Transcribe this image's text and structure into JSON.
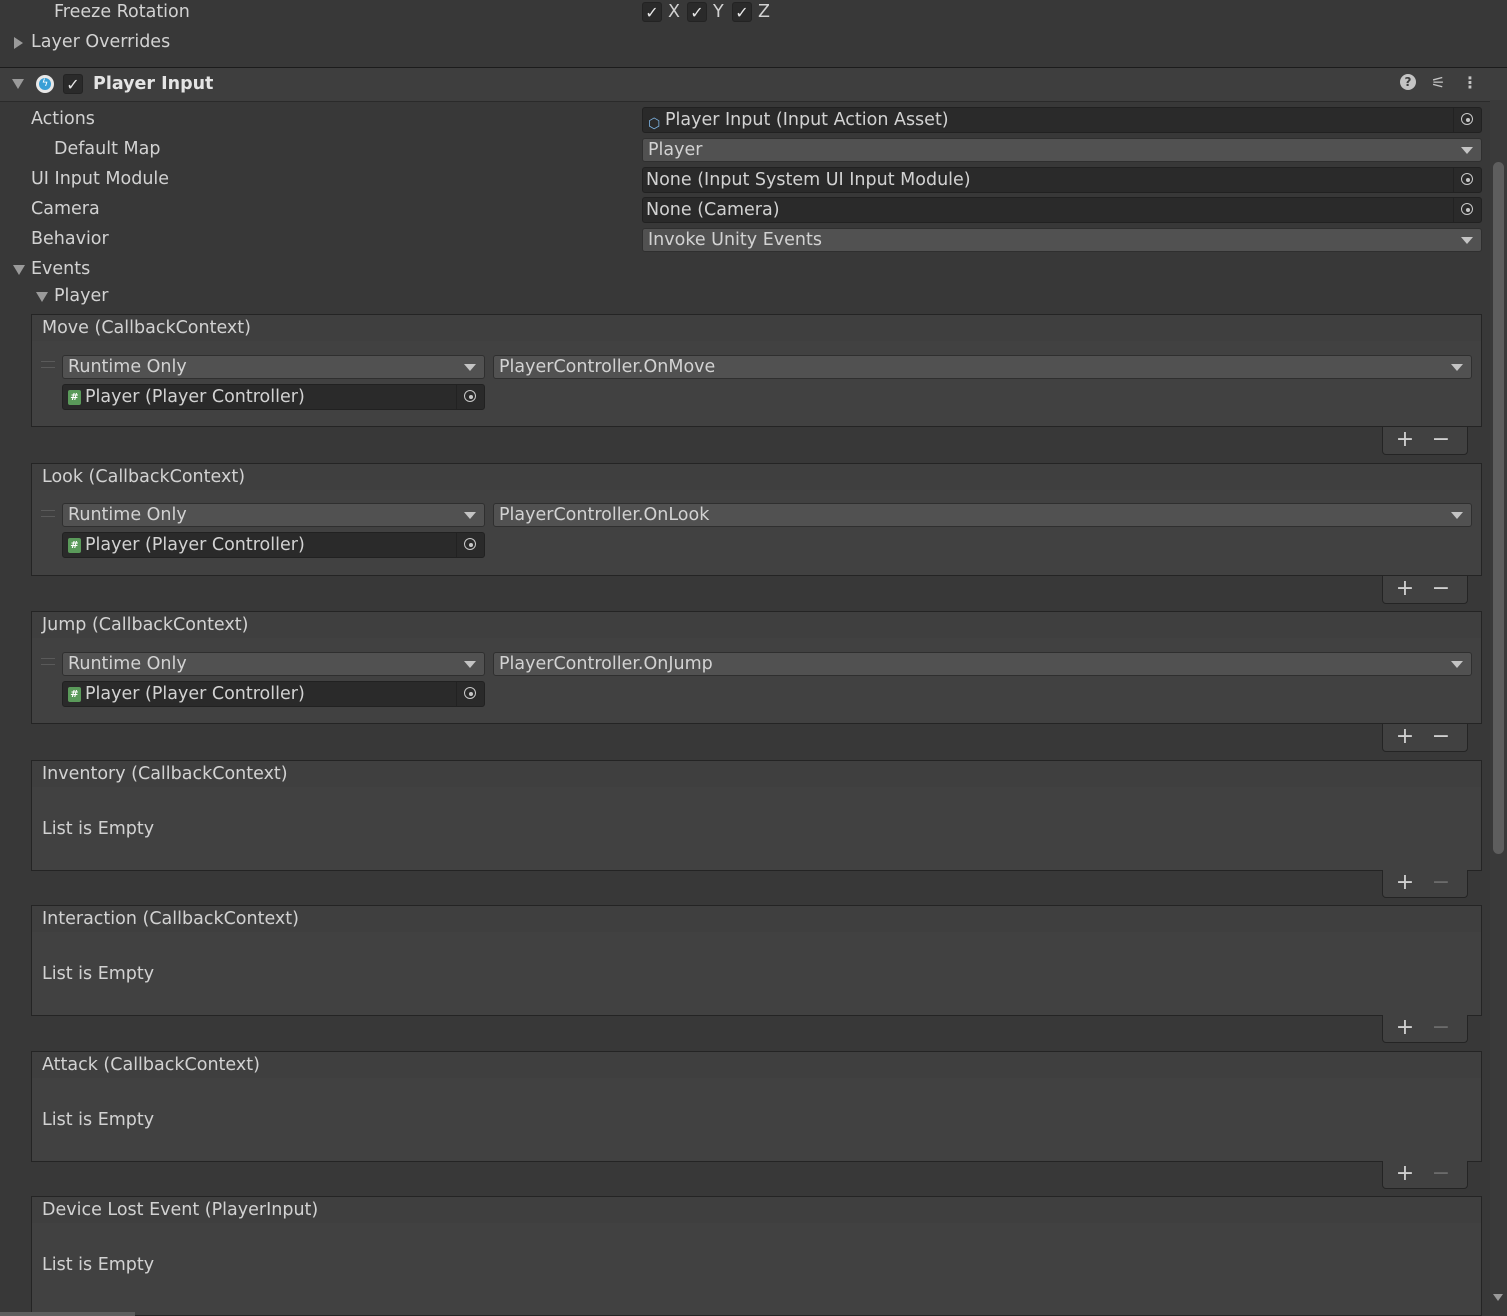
{
  "rigidbody": {
    "freeze_rotation_label": "Freeze Rotation",
    "axes": [
      "X",
      "Y",
      "Z"
    ],
    "layer_overrides_label": "Layer Overrides"
  },
  "component": {
    "title": "Player Input",
    "help_icon": "help-icon",
    "presets_icon": "presets-icon",
    "menu_icon": "kebab-menu-icon"
  },
  "fields": {
    "actions": {
      "label": "Actions",
      "value": "Player Input (Input Action Asset)"
    },
    "default_map": {
      "label": "Default Map",
      "value": "Player"
    },
    "ui_input_module": {
      "label": "UI Input Module",
      "value": "None (Input System UI Input Module)"
    },
    "camera": {
      "label": "Camera",
      "value": "None (Camera)"
    },
    "behavior": {
      "label": "Behavior",
      "value": "Invoke Unity Events"
    }
  },
  "events": {
    "label": "Events",
    "group_label": "Player",
    "list": [
      {
        "header": "Move (CallbackContext)",
        "mode": "Runtime Only",
        "function": "PlayerController.OnMove",
        "target": "Player (Player Controller)"
      },
      {
        "header": "Look (CallbackContext)",
        "mode": "Runtime Only",
        "function": "PlayerController.OnLook",
        "target": "Player (Player Controller)"
      },
      {
        "header": "Jump (CallbackContext)",
        "mode": "Runtime Only",
        "function": "PlayerController.OnJump",
        "target": "Player (Player Controller)"
      },
      {
        "header": "Inventory (CallbackContext)",
        "empty": "List is Empty"
      },
      {
        "header": "Interaction (CallbackContext)",
        "empty": "List is Empty"
      },
      {
        "header": "Attack (CallbackContext)",
        "empty": "List is Empty"
      },
      {
        "header": "Device Lost Event (PlayerInput)",
        "empty": "List is Empty"
      }
    ]
  },
  "footer_buttons": {
    "plus": "+",
    "minus": "−"
  },
  "colors": {
    "background": "#383838",
    "field": "#2a2a2a",
    "dropdown": "#515151",
    "script_icon": "#5a9a5a",
    "input_icon": "#3a9fd6"
  }
}
